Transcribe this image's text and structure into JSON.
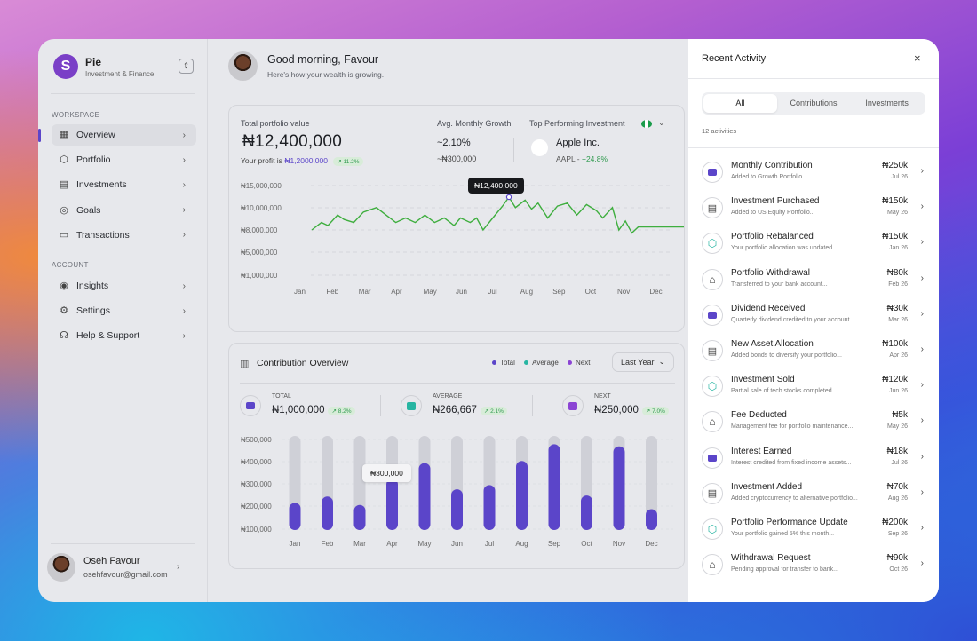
{
  "app": {
    "name": "Pie",
    "subtitle": "Investment & Finance",
    "logo_letter": "S"
  },
  "sidebar": {
    "workspace_label": "WORKSPACE",
    "account_label": "ACCOUNT",
    "workspace_items": [
      {
        "label": "Overview",
        "icon": "grid-icon",
        "active": true
      },
      {
        "label": "Portfolio",
        "icon": "box-icon"
      },
      {
        "label": "Investments",
        "icon": "chart-icon"
      },
      {
        "label": "Goals",
        "icon": "target-icon"
      },
      {
        "label": "Transactions",
        "icon": "cash-icon"
      }
    ],
    "account_items": [
      {
        "label": "Insights",
        "icon": "compass-icon"
      },
      {
        "label": "Settings",
        "icon": "gear-icon"
      },
      {
        "label": "Help & Support",
        "icon": "headset-icon"
      }
    ],
    "user": {
      "name": "Oseh Favour",
      "email": "osehfavour@gmail.com"
    }
  },
  "header": {
    "greeting": "Good morning, Favour",
    "subtitle": "Here's how your wealth is growing."
  },
  "portfolio": {
    "label": "Total portfolio value",
    "value": "₦12,400,000",
    "profit_prefix": "Your profit is",
    "profit_value": "₦1,2000,000",
    "profit_change": "↗ 11.2%",
    "avg_label": "Avg. Monthly Growth",
    "avg_pct": "~2.10%",
    "avg_amount": "~₦300,000",
    "top_label": "Top Performing Investment",
    "top_name": "Apple Inc.",
    "top_ticker": "AAPL",
    "top_change": "+24.8%",
    "tooltip": "₦12,400,000"
  },
  "contribution": {
    "title": "Contribution Overview",
    "legend": [
      "Total",
      "Average",
      "Next"
    ],
    "period": "Last Year",
    "total_label": "TOTAL",
    "total_value": "₦1,000,000",
    "total_change": "↗ 8.2%",
    "average_label": "AVERAGE",
    "average_value": "₦266,667",
    "average_change": "↗ 2.1%",
    "next_label": "NEXT",
    "next_value": "₦250,000",
    "next_change": "↗ 7.0%",
    "tooltip": "₦300,000"
  },
  "chart_data": [
    {
      "type": "line",
      "title": "",
      "x": [
        "Jan",
        "Feb",
        "Mar",
        "Apr",
        "May",
        "Jun",
        "Jul",
        "Aug",
        "Sep",
        "Oct",
        "Nov",
        "Dec"
      ],
      "yticks": [
        "₦15,000,000",
        "₦10,000,000",
        "₦8,000,000",
        "₦5,000,000",
        "₦1,000,000"
      ],
      "points": [
        [
          0,
          8.0
        ],
        [
          0.3,
          9.0
        ],
        [
          0.5,
          8.6
        ],
        [
          0.8,
          10.0
        ],
        [
          1.0,
          9.4
        ],
        [
          1.3,
          9.0
        ],
        [
          1.6,
          10.4
        ],
        [
          2.0,
          11.0
        ],
        [
          2.3,
          10.0
        ],
        [
          2.6,
          9.0
        ],
        [
          2.9,
          9.6
        ],
        [
          3.2,
          9.0
        ],
        [
          3.5,
          10.0
        ],
        [
          3.8,
          9.0
        ],
        [
          4.1,
          9.6
        ],
        [
          4.4,
          8.6
        ],
        [
          4.6,
          9.6
        ],
        [
          4.9,
          9.0
        ],
        [
          5.1,
          9.6
        ],
        [
          5.3,
          8.0
        ],
        [
          5.6,
          9.6
        ],
        [
          5.9,
          11.2
        ],
        [
          6.1,
          12.4
        ],
        [
          6.3,
          11.0
        ],
        [
          6.6,
          12.0
        ],
        [
          6.8,
          10.8
        ],
        [
          7.0,
          11.6
        ],
        [
          7.3,
          9.6
        ],
        [
          7.6,
          11.2
        ],
        [
          7.9,
          11.6
        ],
        [
          8.2,
          10.0
        ],
        [
          8.5,
          11.4
        ],
        [
          8.8,
          10.6
        ],
        [
          9.0,
          9.6
        ],
        [
          9.3,
          11.0
        ],
        [
          9.5,
          8.0
        ],
        [
          9.7,
          9.2
        ],
        [
          9.9,
          7.6
        ],
        [
          10.1,
          8.4
        ],
        [
          10.5,
          8.4
        ],
        [
          11.0,
          8.4
        ],
        [
          11.5,
          8.4
        ],
        [
          11.6,
          8.4
        ]
      ],
      "ylim": [
        1,
        15
      ]
    },
    {
      "type": "bar",
      "title": "",
      "categories": [
        "Jan",
        "Feb",
        "Mar",
        "Apr",
        "May",
        "Jun",
        "Jul",
        "Aug",
        "Sep",
        "Oct",
        "Nov",
        "Dec"
      ],
      "values": [
        180000,
        210000,
        170000,
        295000,
        370000,
        245000,
        265000,
        380000,
        460000,
        215000,
        450000,
        150000
      ],
      "yticks": [
        "₦500,000",
        "₦400,000",
        "₦300,000",
        "₦200,000",
        "₦100,000"
      ],
      "ylim": [
        100000,
        500000
      ]
    }
  ],
  "activity": {
    "title": "Recent Activity",
    "tabs": [
      "All",
      "Contributions",
      "Investments"
    ],
    "count": "12 activities",
    "items": [
      {
        "title": "Monthly Contribution",
        "desc": "Added to Growth Portfolio...",
        "amount": "₦250k",
        "date": "Jul 26",
        "icon": "wallet-icon"
      },
      {
        "title": "Investment Purchased",
        "desc": "Added to US Equity Portfolio...",
        "amount": "₦150k",
        "date": "May 26",
        "icon": "chart-icon"
      },
      {
        "title": "Portfolio Rebalanced",
        "desc": "Your portfolio allocation was updated...",
        "amount": "₦150k",
        "date": "Jan 26",
        "icon": "cube-icon"
      },
      {
        "title": "Portfolio Withdrawal",
        "desc": "Transferred to your bank account...",
        "amount": "₦80k",
        "date": "Feb 26",
        "icon": "bank-icon"
      },
      {
        "title": "Dividend Received",
        "desc": "Quarterly dividend credited to your account...",
        "amount": "₦30k",
        "date": "Mar 26",
        "icon": "wallet-icon"
      },
      {
        "title": "New Asset Allocation",
        "desc": "Added bonds to diversify your portfolio...",
        "amount": "₦100k",
        "date": "Apr 26",
        "icon": "chart-icon"
      },
      {
        "title": "Investment Sold",
        "desc": "Partial sale of tech stocks completed...",
        "amount": "₦120k",
        "date": "Jun 26",
        "icon": "cube-icon"
      },
      {
        "title": "Fee Deducted",
        "desc": "Management fee for portfolio maintenance...",
        "amount": "₦5k",
        "date": "May 26",
        "icon": "bank-icon"
      },
      {
        "title": "Interest Earned",
        "desc": "Interest credited from fixed income assets...",
        "amount": "₦18k",
        "date": "Jul 26",
        "icon": "wallet-icon"
      },
      {
        "title": "Investment Added",
        "desc": "Added cryptocurrency to alternative portfolio...",
        "amount": "₦70k",
        "date": "Aug 26",
        "icon": "chart-icon"
      },
      {
        "title": "Portfolio Performance Update",
        "desc": "Your portfolio gained 5% this month...",
        "amount": "₦200k",
        "date": "Sep 26",
        "icon": "cube-icon"
      },
      {
        "title": "Withdrawal Request",
        "desc": "Pending approval for transfer to bank...",
        "amount": "₦90k",
        "date": "Oct 26",
        "icon": "bank-icon"
      }
    ]
  },
  "colors": {
    "accent": "#5b45c9",
    "bar": "#5b45c9",
    "bar_track": "#cfd0d7",
    "line": "#3fae3f",
    "positive": "#2f9a4e",
    "average": "#27b5a2",
    "next": "#8b44d4"
  }
}
